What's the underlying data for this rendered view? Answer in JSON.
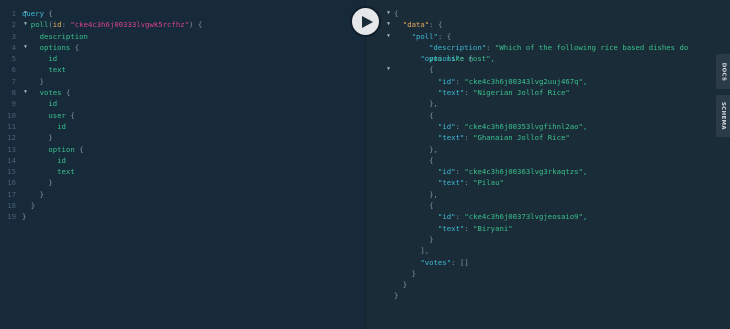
{
  "query_editor": {
    "line_numbers": [
      "1",
      "2",
      "3",
      "4",
      "5",
      "6",
      "7",
      "8",
      "9",
      "10",
      "11",
      "12",
      "13",
      "14",
      "15",
      "16",
      "17",
      "18",
      "19"
    ],
    "lines": {
      "l1": {
        "keyword": "query",
        "brace": "{"
      },
      "l2": {
        "field": "poll",
        "paren_open": "(",
        "arg": "id",
        "colon": ":",
        "value": "\"cke4c3h6j00333lvgwk5rcfhz\"",
        "paren_close": ")",
        "brace": "{"
      },
      "l3": {
        "field": "description"
      },
      "l4": {
        "field": "options",
        "brace": "{"
      },
      "l5": {
        "field": "id"
      },
      "l6": {
        "field": "text"
      },
      "l7": {
        "brace": "}"
      },
      "l8": {
        "field": "votes",
        "brace": "{"
      },
      "l9": {
        "field": "id"
      },
      "l10": {
        "field": "user",
        "brace": "{"
      },
      "l11": {
        "field": "id"
      },
      "l12": {
        "brace": "}"
      },
      "l13": {
        "field": "option",
        "brace": "{"
      },
      "l14": {
        "field": "id"
      },
      "l15": {
        "field": "text"
      },
      "l16": {
        "brace": "}"
      },
      "l17": {
        "brace": "}"
      },
      "l18": {
        "brace": "}"
      },
      "l19": {
        "brace": "}"
      }
    }
  },
  "result_viewer": {
    "open_brace": "{",
    "data_key": "\"data\"",
    "poll_key": "\"poll\"",
    "description_key": "\"description\"",
    "description_value": "\"Which of the following rice based dishes do you like most\",",
    "options_key": "\"options\"",
    "id_key": "\"id\"",
    "text_key": "\"text\"",
    "votes_key": "\"votes\"",
    "votes_value": "[]",
    "options": [
      {
        "id": "\"cke4c3h6j00343lvg2uuj467q\",",
        "text": "\"Nigerian Jollof Rice\""
      },
      {
        "id": "\"cke4c3h6j00353lvgfihnl2ao\",",
        "text": "\"Ghanaian Jollof Rice\""
      },
      {
        "id": "\"cke4c3h6j00363lvg3rkaqtzs\",",
        "text": "\"Pilau\""
      },
      {
        "id": "\"cke4c3h6j00373lvgjeosaio9\",",
        "text": "\"Biryani\""
      }
    ],
    "punct": {
      "colon": ":",
      "colon_brace": ": {",
      "colon_bracket": ": [",
      "brace_open": "{",
      "brace_close": "}",
      "brace_close_comma": "},",
      "bracket_close_comma": "],"
    }
  },
  "toolbar": {
    "execute_icon": "play-icon"
  },
  "side_tabs": {
    "docs": "DOCS",
    "schema": "SCHEMA"
  },
  "colors": {
    "background": "#172a3a",
    "keyword": "#3db9d3",
    "field": "#39c08b",
    "string": "#d64292",
    "argument": "#e5ad5c"
  }
}
